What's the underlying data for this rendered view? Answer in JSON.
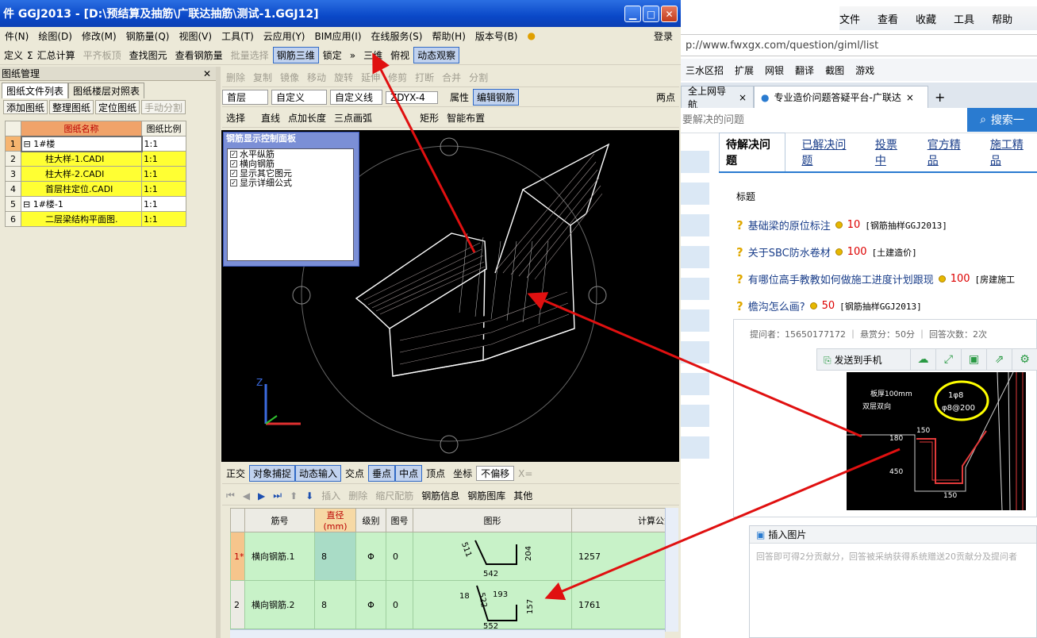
{
  "app": {
    "title": "件 GGJ2013 - [D:\\预结算及抽筋\\广联达抽筋\\测试-1.GGJ12]",
    "menu": [
      "件(N)",
      "绘图(D)",
      "修改(M)",
      "钢筋量(Q)",
      "视图(V)",
      "工具(T)",
      "云应用(Y)",
      "BIM应用(I)",
      "在线服务(S)",
      "帮助(H)",
      "版本号(B)"
    ],
    "login": "登录",
    "toolbar1": [
      "定义",
      "汇总计算",
      "平齐板顶",
      "查找图元",
      "查看钢筋量",
      "批量选择",
      "钢筋三维",
      "锁定",
      "三维",
      "俯视",
      "动态观察"
    ],
    "toolbar2": [
      "删除",
      "复制",
      "镜像",
      "移动",
      "旋转",
      "延伸",
      "修剪",
      "打断",
      "合并",
      "分割"
    ],
    "toolbar3": {
      "floor": "首层",
      "type": "自定义",
      "line": "自定义线",
      "code": "ZDYX-4",
      "props": "属性",
      "edit": "编辑钢筋",
      "two_points": "两点"
    },
    "toolbar4": [
      "选择",
      "直线",
      "点加长度",
      "三点画弧",
      "矩形",
      "智能布置"
    ],
    "snapbar": [
      "正交",
      "对象捕捉",
      "动态输入",
      "交点",
      "垂点",
      "中点",
      "顶点",
      "坐标",
      "不偏移",
      "X="
    ],
    "rebarbar": [
      "插入",
      "删除",
      "缩尺配筋",
      "钢筋信息",
      "钢筋图库",
      "其他"
    ]
  },
  "panel": {
    "title": "图纸管理",
    "tabs": [
      "图纸文件列表",
      "图纸楼层对照表"
    ],
    "buttons": [
      "添加图纸",
      "整理图纸",
      "定位图纸",
      "手动分割"
    ],
    "headers": [
      "图纸名称",
      "图纸比例"
    ],
    "rows": [
      {
        "n": "1",
        "name": "1#楼",
        "scale": "1:1"
      },
      {
        "n": "2",
        "name": "柱大样-1.CADI",
        "scale": "1:1"
      },
      {
        "n": "3",
        "name": "柱大样-2.CADI",
        "scale": "1:1"
      },
      {
        "n": "4",
        "name": "首层柱定位.CADI",
        "scale": "1:1"
      },
      {
        "n": "5",
        "name": "1#楼-1",
        "scale": "1:1"
      },
      {
        "n": "6",
        "name": "二层梁结构平面图.",
        "scale": "1:1"
      }
    ]
  },
  "canvas": {
    "control_title": "钢筋显示控制面板",
    "checks": [
      "水平纵筋",
      "横向钢筋",
      "显示其它图元",
      "显示详细公式"
    ],
    "axis_z": "Z"
  },
  "rebar_table": {
    "headers": [
      "筋号",
      "直径(mm)",
      "级别",
      "图号",
      "图形",
      "计算公式"
    ],
    "rows": [
      {
        "n": "1*",
        "name": "横向钢筋.1",
        "d": "8",
        "grade": "Φ",
        "fig": "0",
        "dims": [
          "511",
          "204",
          "542"
        ],
        "calc": "1257"
      },
      {
        "n": "2",
        "name": "横向钢筋.2",
        "d": "8",
        "grade": "Φ",
        "fig": "0",
        "dims": [
          "18",
          "522",
          "193",
          "157",
          "552"
        ],
        "calc": "1761"
      }
    ]
  },
  "browser": {
    "menu": [
      "文件",
      "查看",
      "收藏",
      "工具",
      "帮助"
    ],
    "url": "p://www.fwxgx.com/question/giml/list",
    "fav": [
      "三水区招",
      "扩展",
      "网银",
      "翻译",
      "截图",
      "游戏"
    ],
    "tabs": [
      "全上网导航",
      "专业造价问题答疑平台-广联达"
    ],
    "search_placeholder": "要解决的问题",
    "search_btn": "搜索一",
    "qtabs": [
      "待解决问题",
      "已解决问题",
      "投票中",
      "官方精品",
      "施工精品"
    ],
    "col_title": "标题",
    "questions": [
      {
        "t": "基础梁的原位标注",
        "pts": "10",
        "tag": "[钢筋抽样GGJ2013]"
      },
      {
        "t": "关于SBC防水卷材",
        "pts": "100",
        "tag": "[土建造价]"
      },
      {
        "t": "有哪位高手教教如何做施工进度计划跟现",
        "pts": "100",
        "tag": "[房建施工"
      },
      {
        "t": "檐沟怎么画?",
        "pts": "50",
        "tag": "[钢筋抽样GGJ2013]"
      }
    ],
    "meta": "提问者：15650177172 ｜ 悬赏分：50分 ｜ 回答次数：2次",
    "send_phone": "发送到手机",
    "drawing_texts": [
      "板厚100mm",
      "双层双向",
      "1φ8",
      "φ8@200",
      "150",
      "180",
      "450",
      "150"
    ],
    "insert_image": "插入图片",
    "answer_hint": "回答即可得2分贡献分，回答被采纳获得系统赠送20贡献分及提问者"
  }
}
